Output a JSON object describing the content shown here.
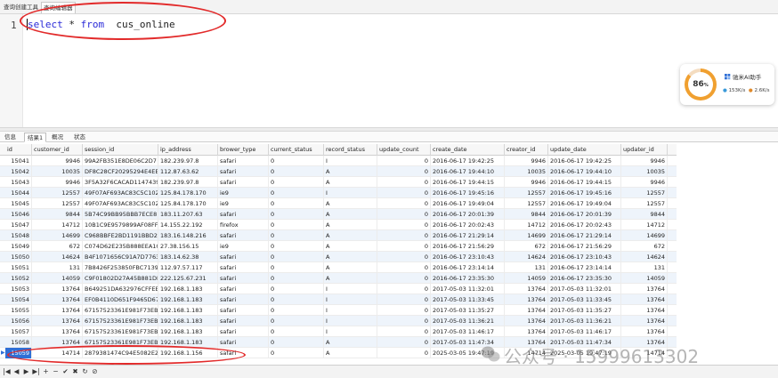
{
  "top_tabs": [
    "查询创建工具",
    "查询编辑器"
  ],
  "editor": {
    "line_number": "1",
    "sql_keyword_select": "select",
    "sql_star": "*",
    "sql_keyword_from": "from",
    "sql_table": "cus_online"
  },
  "widget": {
    "gauge_value": "86",
    "gauge_unit": "%",
    "title": "驰米AI助手",
    "upload": "153K/s",
    "download": "2.6K/s",
    "gauge_fraction": 0.86
  },
  "result_tabs": [
    "信息",
    "结果1",
    "概况",
    "状态"
  ],
  "columns": [
    "id",
    "customer_id",
    "session_id",
    "ip_address",
    "brower_type",
    "current_status",
    "record_status",
    "update_count",
    "create_date",
    "creator_id",
    "update_date",
    "updater_id"
  ],
  "rows": [
    [
      "15041",
      "9946",
      "99A2FB351E8DE06C2D7",
      "182.239.97.8",
      "safari",
      "0",
      "I",
      "0",
      "2016-06-17 19:42:25",
      "9946",
      "2016-06-17 19:42:25",
      "9946"
    ],
    [
      "15042",
      "10035",
      "DF8C28CF20295294E4EE",
      "112.87.63.62",
      "safari",
      "0",
      "A",
      "0",
      "2016-06-17 19:44:10",
      "10035",
      "2016-06-17 19:44:10",
      "10035"
    ],
    [
      "15043",
      "9946",
      "3F5A32F6CACAD1147439",
      "182.239.97.8",
      "safari",
      "0",
      "A",
      "0",
      "2016-06-17 19:44:15",
      "9946",
      "2016-06-17 19:44:15",
      "9946"
    ],
    [
      "15044",
      "12557",
      "49F07AF693AC83C5C102",
      "125.84.178.170",
      "ie9",
      "0",
      "I",
      "0",
      "2016-06-17 19:45:16",
      "12557",
      "2016-06-17 19:45:16",
      "12557"
    ],
    [
      "15045",
      "12557",
      "49F07AF693AC83C5C102",
      "125.84.178.170",
      "ie9",
      "0",
      "A",
      "0",
      "2016-06-17 19:49:04",
      "12557",
      "2016-06-17 19:49:04",
      "12557"
    ],
    [
      "15046",
      "9844",
      "5B74C99BB95BBB7ECE8",
      "183.11.207.63",
      "safari",
      "0",
      "A",
      "0",
      "2016-06-17 20:01:39",
      "9844",
      "2016-06-17 20:01:39",
      "9844"
    ],
    [
      "15047",
      "14712",
      "10B1C9E9579899AF08FFE",
      "14.155.22.192",
      "firefox",
      "0",
      "A",
      "0",
      "2016-06-17 20:02:43",
      "14712",
      "2016-06-17 20:02:43",
      "14712"
    ],
    [
      "15048",
      "14699",
      "C968BBFE2BD1191BBD22",
      "183.16.148.216",
      "safari",
      "0",
      "A",
      "0",
      "2016-06-17 21:29:14",
      "14699",
      "2016-06-17 21:29:14",
      "14699"
    ],
    [
      "15049",
      "672",
      "C074D62E235B888EEA1C",
      "27.38.156.15",
      "ie9",
      "0",
      "A",
      "0",
      "2016-06-17 21:56:29",
      "672",
      "2016-06-17 21:56:29",
      "672"
    ],
    [
      "15050",
      "14624",
      "B4F1071656C91A7D7763",
      "183.14.62.38",
      "safari",
      "0",
      "A",
      "0",
      "2016-06-17 23:10:43",
      "14624",
      "2016-06-17 23:10:43",
      "14624"
    ],
    [
      "15051",
      "131",
      "7B8426F253850FBC7139C",
      "112.97.57.117",
      "safari",
      "0",
      "A",
      "0",
      "2016-06-17 23:14:14",
      "131",
      "2016-06-17 23:14:14",
      "131"
    ],
    [
      "15052",
      "14059",
      "C9F01802D27A45B881DE",
      "222.125.67.231",
      "safari",
      "0",
      "A",
      "0",
      "2016-06-17 23:35:30",
      "14059",
      "2016-06-17 23:35:30",
      "14059"
    ],
    [
      "15053",
      "13764",
      "B649251DA632976CFFEE",
      "192.168.1.183",
      "safari",
      "0",
      "I",
      "0",
      "2017-05-03 11:32:01",
      "13764",
      "2017-05-03 11:32:01",
      "13764"
    ],
    [
      "15054",
      "13764",
      "EF0B4110D651F9465D67",
      "192.168.1.183",
      "safari",
      "0",
      "I",
      "0",
      "2017-05-03 11:33:45",
      "13764",
      "2017-05-03 11:33:45",
      "13764"
    ],
    [
      "15055",
      "13764",
      "67157523361E981F73EB6",
      "192.168.1.183",
      "safari",
      "0",
      "I",
      "0",
      "2017-05-03 11:35:27",
      "13764",
      "2017-05-03 11:35:27",
      "13764"
    ],
    [
      "15056",
      "13764",
      "67157523361E981F73EB6",
      "192.168.1.183",
      "safari",
      "0",
      "I",
      "0",
      "2017-05-03 11:36:21",
      "13764",
      "2017-05-03 11:36:21",
      "13764"
    ],
    [
      "15057",
      "13764",
      "67157523361E981F73EB6",
      "192.168.1.183",
      "safari",
      "0",
      "I",
      "0",
      "2017-05-03 11:46:17",
      "13764",
      "2017-05-03 11:46:17",
      "13764"
    ],
    [
      "15058",
      "13764",
      "67157523361E981F73EB6",
      "192.168.1.183",
      "safari",
      "0",
      "A",
      "0",
      "2017-05-03 11:47:34",
      "13764",
      "2017-05-03 11:47:34",
      "13764"
    ],
    [
      "15059",
      "14714",
      "2879381474C94E5082E21",
      "192.168.1.156",
      "safari",
      "0",
      "A",
      "0",
      "2025-03-05 19:47:19",
      "14714",
      "2025-03-05 19:47:19",
      "14714"
    ]
  ],
  "toolbar_icons": [
    "|◀",
    "◀",
    "▶",
    "▶|",
    "+",
    "−",
    "✔",
    "✖",
    "↻",
    "⊘"
  ],
  "watermark": "公众号 · 15999613302",
  "colors": {
    "annotation": "#e22a2a",
    "selection": "#2f6fd6",
    "alt_row": "#eef4fb",
    "keyword": "#2a2ad8",
    "gauge": "#f0a030"
  }
}
